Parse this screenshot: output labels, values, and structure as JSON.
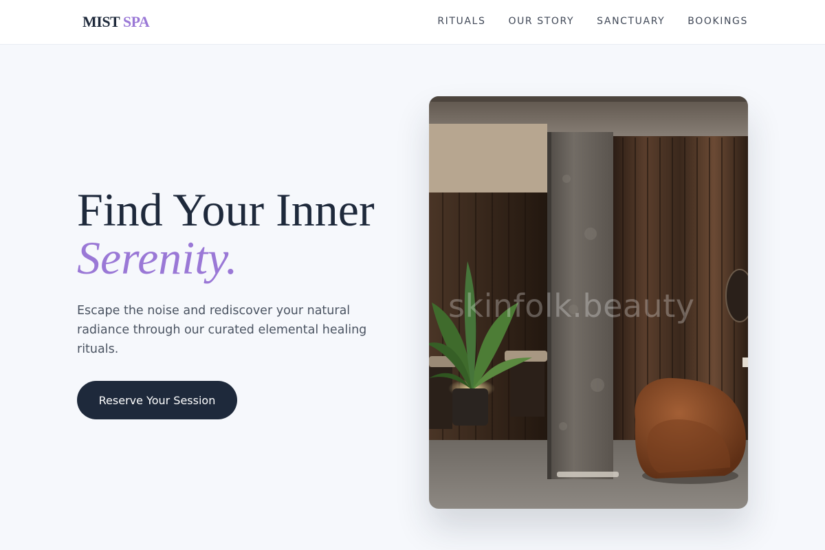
{
  "brand": {
    "name_primary": "MIST",
    "name_secondary": "SPA"
  },
  "nav": {
    "items": [
      {
        "label": "RITUALS"
      },
      {
        "label": "OUR STORY"
      },
      {
        "label": "SANCTUARY"
      },
      {
        "label": "BOOKINGS"
      }
    ]
  },
  "hero": {
    "title_line1": "Find Your Inner",
    "title_line2": "Serenity.",
    "subtitle": "Escape the noise and rediscover your natural radiance through our curated elemental healing rituals.",
    "cta_label": "Reserve Your Session",
    "image": {
      "description_icon": "spa-interior-photo",
      "watermark": "skinfolk.beauty"
    }
  },
  "colors": {
    "primary_dark": "#1e293b",
    "accent_lavender": "#9a78d6",
    "background": "#f6f8fc",
    "header_bg": "#ffffff"
  }
}
